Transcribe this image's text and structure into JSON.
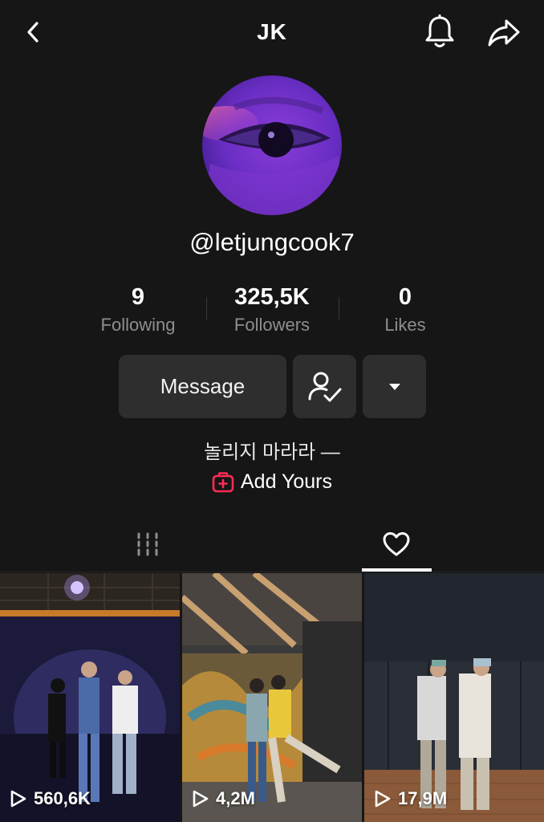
{
  "header": {
    "title": "JK"
  },
  "profile": {
    "username": "@letjungcook7",
    "bio": "놀리지 마라라 —",
    "add_yours_label": "Add Yours"
  },
  "stats": [
    {
      "value": "9",
      "label": "Following"
    },
    {
      "value": "325,5K",
      "label": "Followers"
    },
    {
      "value": "0",
      "label": "Likes"
    }
  ],
  "actions": {
    "message_label": "Message"
  },
  "colors": {
    "background": "#161616",
    "button": "#2e2e2e",
    "accent_red": "#fe2c55",
    "muted_text": "#8e8e8e"
  },
  "icons": [
    "back-arrow-icon",
    "bell-icon",
    "share-icon",
    "person-check-icon",
    "caret-down-icon",
    "add-yours-icon",
    "grid-icon",
    "heart-icon",
    "play-icon"
  ],
  "videos": [
    {
      "views": "560,6K"
    },
    {
      "views": "4,2M"
    },
    {
      "views": "17,9M"
    }
  ]
}
